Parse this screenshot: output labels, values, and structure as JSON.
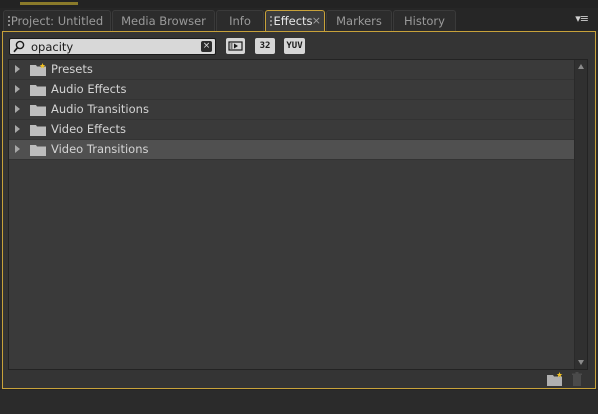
{
  "tabs": [
    {
      "label": "Project: Untitled",
      "active": false
    },
    {
      "label": "Media Browser",
      "active": false
    },
    {
      "label": "Info",
      "active": false
    },
    {
      "label": "Effects",
      "active": true
    },
    {
      "label": "Markers",
      "active": false
    },
    {
      "label": "History",
      "active": false
    }
  ],
  "search": {
    "value": "opacity",
    "clear_label": "×"
  },
  "toolbar": {
    "accelerated_label": "",
    "bit32_label": "32",
    "yuv_label": "YUV"
  },
  "tree": {
    "items": [
      {
        "label": "Presets",
        "icon": "preset-folder-icon"
      },
      {
        "label": "Audio Effects",
        "icon": "folder-icon"
      },
      {
        "label": "Audio Transitions",
        "icon": "folder-icon"
      },
      {
        "label": "Video Effects",
        "icon": "folder-icon"
      },
      {
        "label": "Video Transitions",
        "icon": "folder-icon"
      }
    ],
    "selected_index": 4
  },
  "colors": {
    "accent": "#c8a23a",
    "panel": "#343434",
    "selection": "#505050"
  }
}
